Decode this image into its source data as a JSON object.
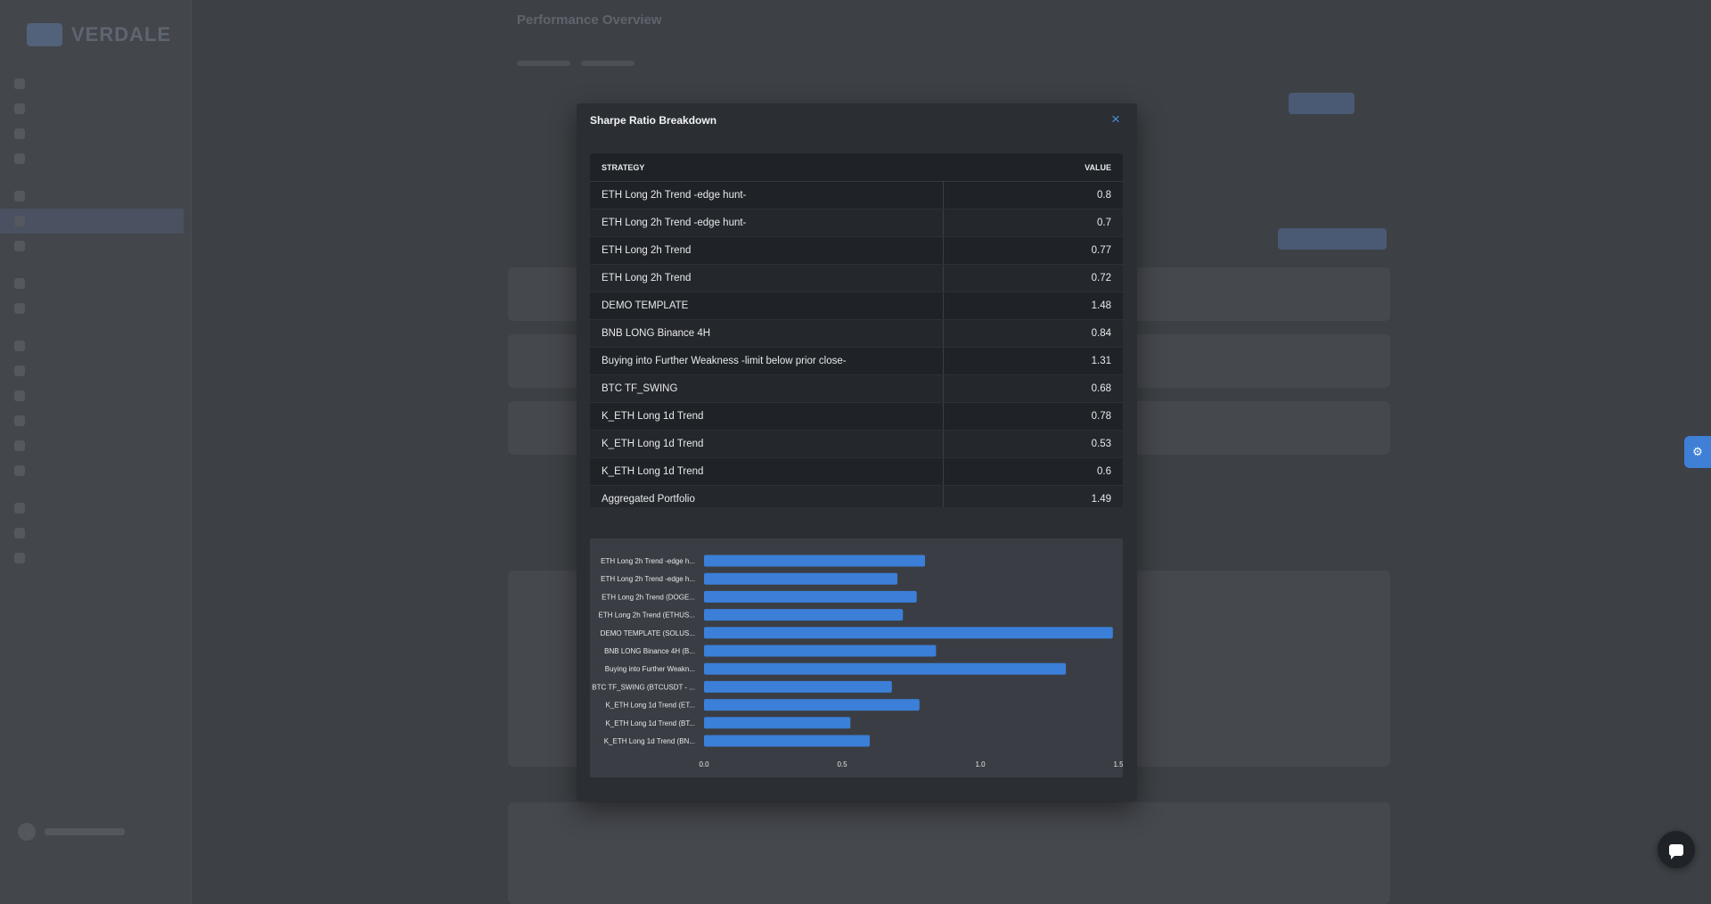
{
  "background": {
    "logo_text": "VERDALE",
    "page_title": "Performance Overview"
  },
  "modal": {
    "title": "Sharpe Ratio Breakdown",
    "close_label": "×"
  },
  "table": {
    "headers": {
      "strategy": "STRATEGY",
      "value": "VALUE"
    },
    "rows": [
      {
        "strategy": "ETH Long 2h Trend -edge hunt-",
        "value": "0.8"
      },
      {
        "strategy": "ETH Long 2h Trend -edge hunt-",
        "value": "0.7"
      },
      {
        "strategy": "ETH Long 2h Trend",
        "value": "0.77"
      },
      {
        "strategy": "ETH Long 2h Trend",
        "value": "0.72"
      },
      {
        "strategy": "DEMO TEMPLATE",
        "value": "1.48"
      },
      {
        "strategy": "BNB LONG Binance 4H",
        "value": "0.84"
      },
      {
        "strategy": "Buying into Further Weakness -limit below prior close-",
        "value": "1.31"
      },
      {
        "strategy": "BTC TF_SWING",
        "value": "0.68"
      },
      {
        "strategy": "K_ETH Long 1d Trend",
        "value": "0.78"
      },
      {
        "strategy": "K_ETH Long 1d Trend",
        "value": "0.53"
      },
      {
        "strategy": "K_ETH Long 1d Trend",
        "value": "0.6"
      },
      {
        "strategy": "Aggregated Portfolio",
        "value": "1.49"
      }
    ]
  },
  "chart_data": {
    "type": "bar",
    "orientation": "horizontal",
    "categories": [
      "ETH Long 2h Trend -edge h...",
      "ETH Long 2h Trend -edge h...",
      "ETH Long 2h Trend (DOGE...",
      "ETH Long 2h Trend (ETHUS...",
      "DEMO TEMPLATE (SOLUS...",
      "BNB LONG Binance 4H (B...",
      "Buying into Further Weakn...",
      "BTC TF_SWING (BTCUSDT - ...",
      "K_ETH Long 1d Trend (ET...",
      "K_ETH Long 1d Trend (BT...",
      "K_ETH Long 1d Trend (BN..."
    ],
    "values": [
      0.8,
      0.7,
      0.77,
      0.72,
      1.48,
      0.84,
      1.31,
      0.68,
      0.78,
      0.53,
      0.6
    ],
    "xlim": [
      0,
      1.5
    ],
    "xticks": [
      "0.0",
      "0.5",
      "1.0",
      "1.5"
    ],
    "grid": false,
    "bar_color": "#3b7fd8"
  },
  "colors": {
    "accent": "#4a90e2",
    "bar": "#3b7fd8"
  }
}
